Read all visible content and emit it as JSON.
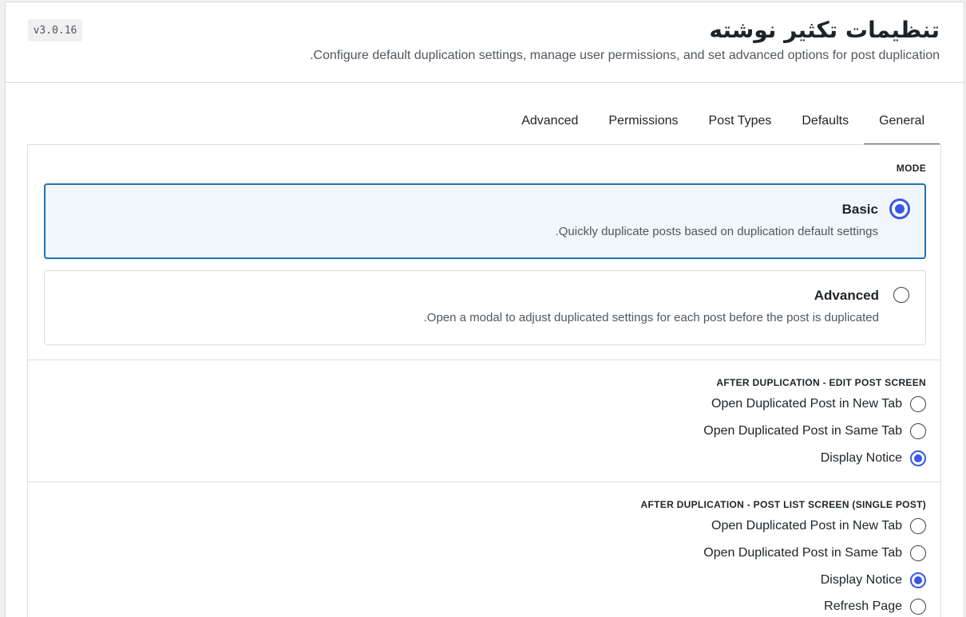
{
  "header": {
    "title": "تنظیمات تکثیر نوشته",
    "subtitle": "Configure default duplication settings, manage user permissions, and set advanced options for post duplication.",
    "version": "v3.0.16"
  },
  "tabs": [
    {
      "label": "General",
      "active": true
    },
    {
      "label": "Defaults",
      "active": false
    },
    {
      "label": "Post Types",
      "active": false
    },
    {
      "label": "Permissions",
      "active": false
    },
    {
      "label": "Advanced",
      "active": false
    }
  ],
  "mode": {
    "label": "MODE",
    "options": [
      {
        "title": "Basic",
        "desc": "Quickly duplicate posts based on duplication default settings.",
        "checked": true
      },
      {
        "title": "Advanced",
        "desc": "Open a modal to adjust duplicated settings for each post before the post is duplicated.",
        "checked": false
      }
    ]
  },
  "edit_screen": {
    "label": "AFTER DUPLICATION - EDIT POST SCREEN",
    "options": [
      {
        "label": "Open Duplicated Post in New Tab",
        "checked": false
      },
      {
        "label": "Open Duplicated Post in Same Tab",
        "checked": false
      },
      {
        "label": "Display Notice",
        "checked": true
      }
    ]
  },
  "list_screen": {
    "label": "AFTER DUPLICATION - POST LIST SCREEN (SINGLE POST)",
    "options": [
      {
        "label": "Open Duplicated Post in New Tab",
        "checked": false
      },
      {
        "label": "Open Duplicated Post in Same Tab",
        "checked": false
      },
      {
        "label": "Display Notice",
        "checked": true
      },
      {
        "label": "Refresh Page",
        "checked": false
      }
    ]
  },
  "colors": {
    "accent": "#3858e9",
    "selected_border": "#2271b1",
    "selected_bg": "#f0f6fc"
  }
}
